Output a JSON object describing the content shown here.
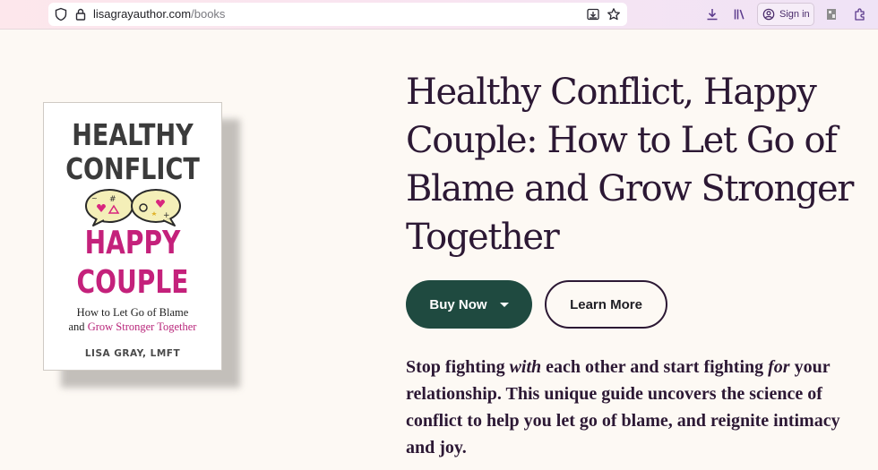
{
  "browser": {
    "url_domain": "lisagrayauthor.com",
    "url_path": "/books",
    "signin_label": "Sign in",
    "icons": [
      "shield-icon",
      "lock-icon",
      "reader-mode-icon",
      "bookmark-star-icon",
      "downloads-icon",
      "library-icon",
      "account-icon",
      "extension-icon",
      "puzzle-icon"
    ]
  },
  "book_cover": {
    "title_line1": "HEALTHY",
    "title_line2": "CONFLICT",
    "title_line3": "HAPPY",
    "title_line4": "COUPLE",
    "subtitle_line1": "How to Let Go of Blame",
    "subtitle_line2_prefix": "and ",
    "subtitle_line2_highlight": "Grow Stronger Together",
    "author": "LISA GRAY, LMFT",
    "accent_color": "#c4217b"
  },
  "book": {
    "title": "Healthy Conflict, Happy Couple: How to Let Go of Blame and Grow Stronger Together",
    "buy_label": "Buy Now",
    "learn_label": "Learn More",
    "desc_part1": "Stop fighting ",
    "desc_em1": "with",
    "desc_part2": " each other and start fighting ",
    "desc_em2": "for",
    "desc_part3": " your relationship. This unique guide uncovers the science of conflict to help you let go of blame, and reignite intimacy and joy."
  },
  "colors": {
    "buy_button": "#1f4a40",
    "title_text": "#2c1834",
    "page_background": "#fdf9f4"
  }
}
